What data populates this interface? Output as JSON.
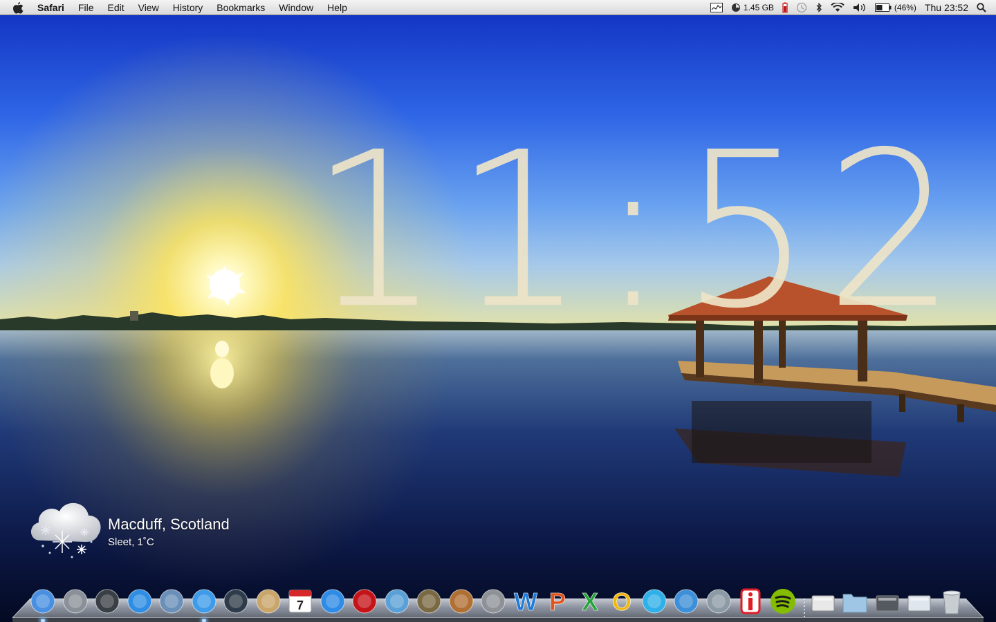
{
  "menubar": {
    "app_name": "Safari",
    "menus": [
      "File",
      "Edit",
      "View",
      "History",
      "Bookmarks",
      "Window",
      "Help"
    ],
    "memory": "1.45 GB",
    "battery": "(46%)",
    "clock": "Thu 23:52",
    "status_icons": [
      "activity-monitor-icon",
      "memory-gauge-icon",
      "battery-app-icon",
      "time-machine-icon",
      "bluetooth-icon",
      "wifi-icon",
      "volume-icon",
      "battery-icon",
      "spotlight-icon"
    ]
  },
  "clock_widget": {
    "hours": "11",
    "separator": ":",
    "minutes": "52"
  },
  "weather": {
    "location": "Macduff, Scotland",
    "condition": "Sleet, 1˚C",
    "icon": "sleet-cloud-icon"
  },
  "dock": {
    "apps": [
      {
        "name": "finder",
        "color": "#4a90e2",
        "running": true
      },
      {
        "name": "launchpad",
        "color": "#8a8f98",
        "running": false
      },
      {
        "name": "dashboard",
        "color": "#3a3f46",
        "running": false
      },
      {
        "name": "app-store",
        "color": "#2f8de4",
        "running": false
      },
      {
        "name": "mail",
        "color": "#6a8fb8",
        "running": false
      },
      {
        "name": "safari",
        "color": "#3d9be9",
        "running": true
      },
      {
        "name": "facetime",
        "color": "#2e3b4a",
        "running": false
      },
      {
        "name": "address-book",
        "color": "#c9a56a",
        "running": false
      },
      {
        "name": "ical",
        "color": "#e8e8e8",
        "running": false
      },
      {
        "name": "itunes",
        "color": "#2e8be6",
        "running": false
      },
      {
        "name": "photo-booth",
        "color": "#c4141a",
        "running": false
      },
      {
        "name": "iphoto",
        "color": "#5aa0d6",
        "running": false
      },
      {
        "name": "imovie",
        "color": "#7a6a44",
        "running": false
      },
      {
        "name": "garageband",
        "color": "#b07034",
        "running": false
      },
      {
        "name": "system-preferences",
        "color": "#8e9196",
        "running": false
      },
      {
        "name": "word",
        "color": "#1e7ad9",
        "running": false
      },
      {
        "name": "powerpoint",
        "color": "#e0531b",
        "running": false
      },
      {
        "name": "excel",
        "color": "#27a33b",
        "running": false
      },
      {
        "name": "outlook",
        "color": "#f0b90f",
        "running": false
      },
      {
        "name": "messenger",
        "color": "#2fb0e8",
        "running": false
      },
      {
        "name": "transmission",
        "color": "#3c8fd8",
        "running": false
      },
      {
        "name": "remote-desktop",
        "color": "#8c9aa6",
        "running": false
      },
      {
        "name": "istat",
        "color": "#e21c25",
        "running": false
      },
      {
        "name": "spotify",
        "color": "#84bd00",
        "running": false
      }
    ],
    "stacks": [
      {
        "name": "preview-stack",
        "color": "#e8e8e8"
      },
      {
        "name": "documents-folder",
        "color": "#9fc6e4"
      },
      {
        "name": "downloads-stack",
        "color": "#555a60"
      },
      {
        "name": "screenshot-stack",
        "color": "#dfe6ee"
      },
      {
        "name": "trash",
        "color": "#c8cdd2"
      }
    ]
  },
  "colors": {
    "sky_top": "#1d3fd6",
    "sky_mid": "#4c8af0",
    "horizon": "#f8e26a",
    "water_dark": "#061030",
    "clock_text": "#eee4c8",
    "roof": "#b8522c"
  }
}
